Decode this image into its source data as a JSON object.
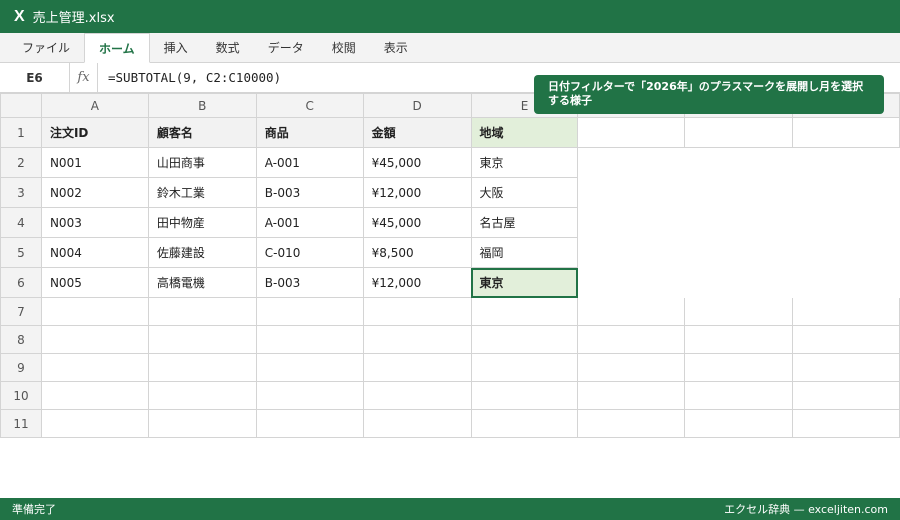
{
  "window": {
    "app_icon": "excel-icon",
    "logo_glyph": "X",
    "title": "売上管理.xlsx"
  },
  "ribbon": {
    "tabs": [
      {
        "label": "ファイル",
        "active": false
      },
      {
        "label": "ホーム",
        "active": true
      },
      {
        "label": "挿入",
        "active": false
      },
      {
        "label": "数式",
        "active": false
      },
      {
        "label": "データ",
        "active": false
      },
      {
        "label": "校閲",
        "active": false
      },
      {
        "label": "表示",
        "active": false
      }
    ]
  },
  "formula_bar": {
    "name_box": "E6",
    "fx_label": "fx",
    "formula": "=SUBTOTAL(9, C2:C10000)"
  },
  "grid": {
    "columns": [
      "A",
      "B",
      "C",
      "D",
      "E",
      "",
      "",
      ""
    ],
    "row_numbers": [
      "1",
      "2",
      "3",
      "4",
      "5",
      "6",
      "7",
      "8",
      "9",
      "10",
      "11"
    ],
    "header": [
      "注文ID",
      "顧客名",
      "商品",
      "金額",
      "地域"
    ],
    "rows": [
      [
        "N001",
        "山田商事",
        "A-001",
        "¥45,000",
        "東京"
      ],
      [
        "N002",
        "鈴木工業",
        "B-003",
        "¥12,000",
        "大阪"
      ],
      [
        "N003",
        "田中物産",
        "A-001",
        "¥45,000",
        "名古屋"
      ],
      [
        "N004",
        "佐藤建設",
        "C-010",
        "¥8,500",
        "福岡"
      ],
      [
        "N005",
        "高橋電機",
        "B-003",
        "¥12,000",
        "東京"
      ]
    ],
    "selected_cell": "E6"
  },
  "callout": {
    "text": "日付フィルターで「2026年」のプラスマークを展開し月を選択する様子"
  },
  "status_bar": {
    "left": "準備完了",
    "right": "エクセル辞典 — exceljiten.com"
  },
  "colors": {
    "brand": "#217346",
    "highlight": "#e2efda"
  }
}
